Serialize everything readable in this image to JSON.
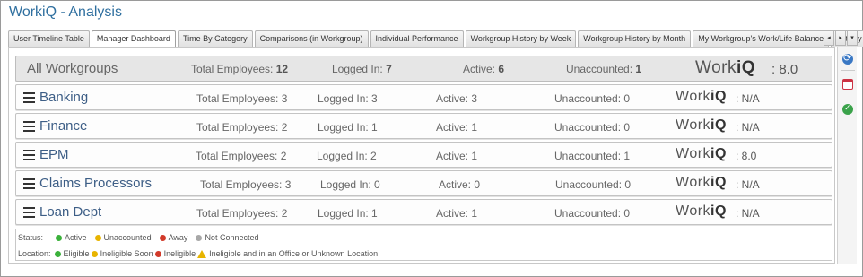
{
  "app": {
    "title": "WorkiQ - Analysis"
  },
  "tabs": [
    {
      "label": "User Timeline Table",
      "active": false
    },
    {
      "label": "Manager Dashboard",
      "active": true
    },
    {
      "label": "Time By Category",
      "active": false
    },
    {
      "label": "Comparisons (in Workgroup)",
      "active": false
    },
    {
      "label": "Individual Performance",
      "active": false
    },
    {
      "label": "Workgroup History by Week",
      "active": false
    },
    {
      "label": "Workgroup History by Month",
      "active": false
    },
    {
      "label": "My Workgroup's Work/Life Balance",
      "active": false
    },
    {
      "label": "Activity Report",
      "active": false
    }
  ],
  "tab_nav": {
    "prev": "◂",
    "next": "▸",
    "menu": "▾"
  },
  "summary": {
    "name": "All Workgroups",
    "total_label": "Total Employees:",
    "total": "12",
    "logged_label": "Logged In:",
    "logged": "7",
    "active_label": "Active:",
    "active": "6",
    "unacc_label": "Unaccounted:",
    "unacc": "1",
    "brand_a": "Work",
    "brand_b": "iQ",
    "score": ": 8.0"
  },
  "workgroups": [
    {
      "name": "Banking",
      "total": "Total Employees: 3",
      "logged": "Logged In: 3",
      "active": "Active: 3",
      "unacc": "Unaccounted: 0",
      "score": ": N/A"
    },
    {
      "name": "Finance",
      "total": "Total Employees: 2",
      "logged": "Logged In: 1",
      "active": "Active: 1",
      "unacc": "Unaccounted: 0",
      "score": ": N/A"
    },
    {
      "name": "EPM",
      "total": "Total Employees: 2",
      "logged": "Logged In: 2",
      "active": "Active: 1",
      "unacc": "Unaccounted: 1",
      "score": ": 8.0"
    },
    {
      "name": "Claims Processors",
      "total": "Total Employees: 3",
      "logged": "Logged In: 0",
      "active": "Active: 0",
      "unacc": "Unaccounted: 0",
      "score": ": N/A"
    },
    {
      "name": "Loan Dept",
      "total": "Total Employees: 2",
      "logged": "Logged In: 1",
      "active": "Active: 1",
      "unacc": "Unaccounted: 0",
      "score": ": N/A"
    }
  ],
  "brand": {
    "a": "Work",
    "b": "iQ"
  },
  "legend": {
    "status_label": "Status:",
    "status": [
      {
        "label": "Active",
        "color": "#3bb13b"
      },
      {
        "label": "Unaccounted",
        "color": "#e8b400"
      },
      {
        "label": "Away",
        "color": "#d23a2a"
      },
      {
        "label": "Not Connected",
        "color": "#a8a8a8"
      }
    ],
    "location_label": "Location:",
    "location": [
      {
        "label": "Eligible",
        "color": "#3bb13b"
      },
      {
        "label": "Ineligible Soon",
        "color": "#e8b400"
      },
      {
        "label": "Ineligible",
        "color": "#d23a2a"
      }
    ],
    "warning_text": "Ineligible and in an Office or Unknown Location"
  },
  "sidebar": {
    "icons": [
      "refresh-icon",
      "calendar-icon",
      "check-icon"
    ]
  }
}
